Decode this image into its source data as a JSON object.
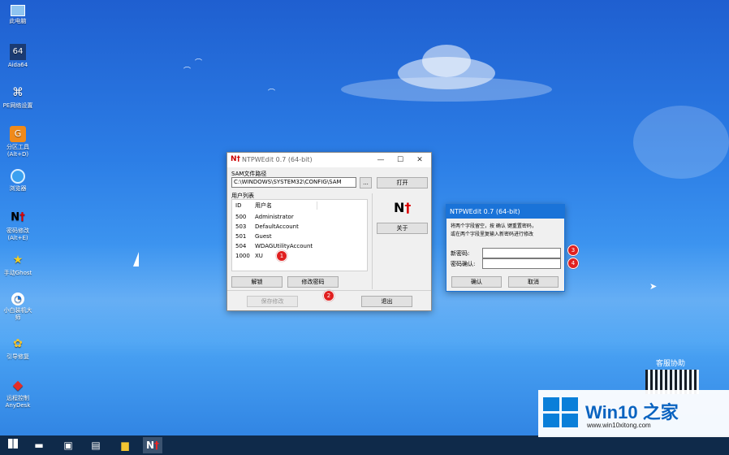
{
  "desktop": {
    "icons": [
      {
        "label": "此电脑",
        "icon": "computer-icon"
      },
      {
        "label": "Aida64",
        "icon": "aida64-icon"
      },
      {
        "label": "PE网络设置",
        "icon": "network-icon"
      },
      {
        "label": "分区工具\n(Alt+D)",
        "icon": "partition-tool-icon"
      },
      {
        "label": "浏览器",
        "icon": "browser-icon"
      },
      {
        "label": "密码修改\n(Alt+E)",
        "icon": "password-tool-icon"
      },
      {
        "label": "手动Ghost",
        "icon": "ghost-icon"
      },
      {
        "label": "小白装机大\n师",
        "icon": "installer-icon"
      },
      {
        "label": "引导修复",
        "icon": "boot-repair-icon"
      },
      {
        "label": "远程控制\nAnyDesk",
        "icon": "anydesk-icon"
      }
    ],
    "support_text": "客服协助"
  },
  "main_window": {
    "title": "NTPWEdit 0.7 (64-bit)",
    "sam_label": "SAM文件路径",
    "sam_path": "C:\\WINDOWS\\SYSTEM32\\CONFIG\\SAM",
    "browse_label": "...",
    "open_label": "打开",
    "users_label": "用户列表",
    "col_id": "ID",
    "col_name": "用户名",
    "users": [
      {
        "id": "500",
        "name": "Administrator"
      },
      {
        "id": "503",
        "name": "DefaultAccount"
      },
      {
        "id": "501",
        "name": "Guest"
      },
      {
        "id": "504",
        "name": "WDAGUtilityAccount"
      },
      {
        "id": "1000",
        "name": "XU"
      }
    ],
    "about_label": "关于",
    "unlock_label": "解锁",
    "change_pwd_label": "修改密码",
    "save_label": "保存修改",
    "exit_label": "退出"
  },
  "pwd_dialog": {
    "title": "NTPWEdit 0.7 (64-bit)",
    "hint_line1": "将两个字段留空，按 确认 键重置密码，",
    "hint_line2": "或在两个字段里复输入新密码进行修改",
    "new_pwd_label": "新密码:",
    "confirm_pwd_label": "密码确认:",
    "ok_label": "确认",
    "cancel_label": "取消"
  },
  "badges": [
    "1",
    "2",
    "3",
    "4"
  ],
  "watermark": {
    "title": "Win10 之家",
    "url": "www.win10xitong.com"
  },
  "colors": {
    "titlebar_active": "#1a73d8",
    "badge": "#e02020",
    "taskbar": "#0f2a4a"
  }
}
